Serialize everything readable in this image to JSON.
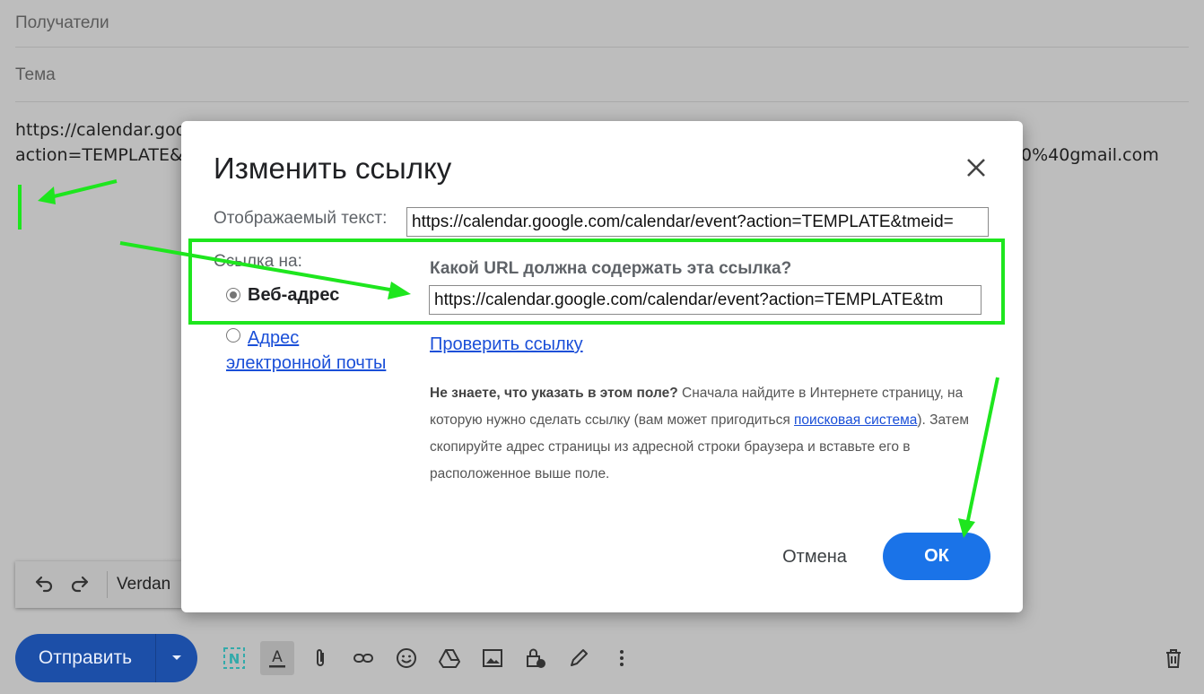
{
  "compose": {
    "recipients_placeholder": "Получатели",
    "subject_placeholder": "Тема",
    "body_line1": "https://calendar.goo",
    "body_line2": "action=TEMPLATE&",
    "body_line2_tail": "0%40gmail.com"
  },
  "format_bar": {
    "font_name": "Verdan"
  },
  "bottom_bar": {
    "send_label": "Отправить"
  },
  "dialog": {
    "title": "Изменить ссылку",
    "display_text_label": "Отображаемый текст:",
    "display_text_value": "https://calendar.google.com/calendar/event?action=TEMPLATE&tmeid=",
    "link_to_label": "Ссылка на:",
    "option_web": "Веб-адрес",
    "option_email_line1": "Адрес",
    "option_email_line2": "электронной почты",
    "url_question": "Какой URL должна содержать эта ссылка?",
    "url_value": "https://calendar.google.com/calendar/event?action=TEMPLATE&tm",
    "check_link": "Проверить ссылку",
    "help_bold": "Не знаете, что указать в этом поле?",
    "help_part1": " Сначала найдите в Интернете страницу, на которую нужно сделать ссылку (вам может пригодиться ",
    "help_link": "поисковая система",
    "help_part2": "). Затем скопируйте адрес страницы из адресной строки браузера и вставьте его в расположенное выше поле.",
    "cancel_label": "Отмена",
    "ok_label": "ОК"
  },
  "colors": {
    "highlight": "#1ee61e",
    "primary": "#1a73e8",
    "link": "#1a4fd8"
  }
}
